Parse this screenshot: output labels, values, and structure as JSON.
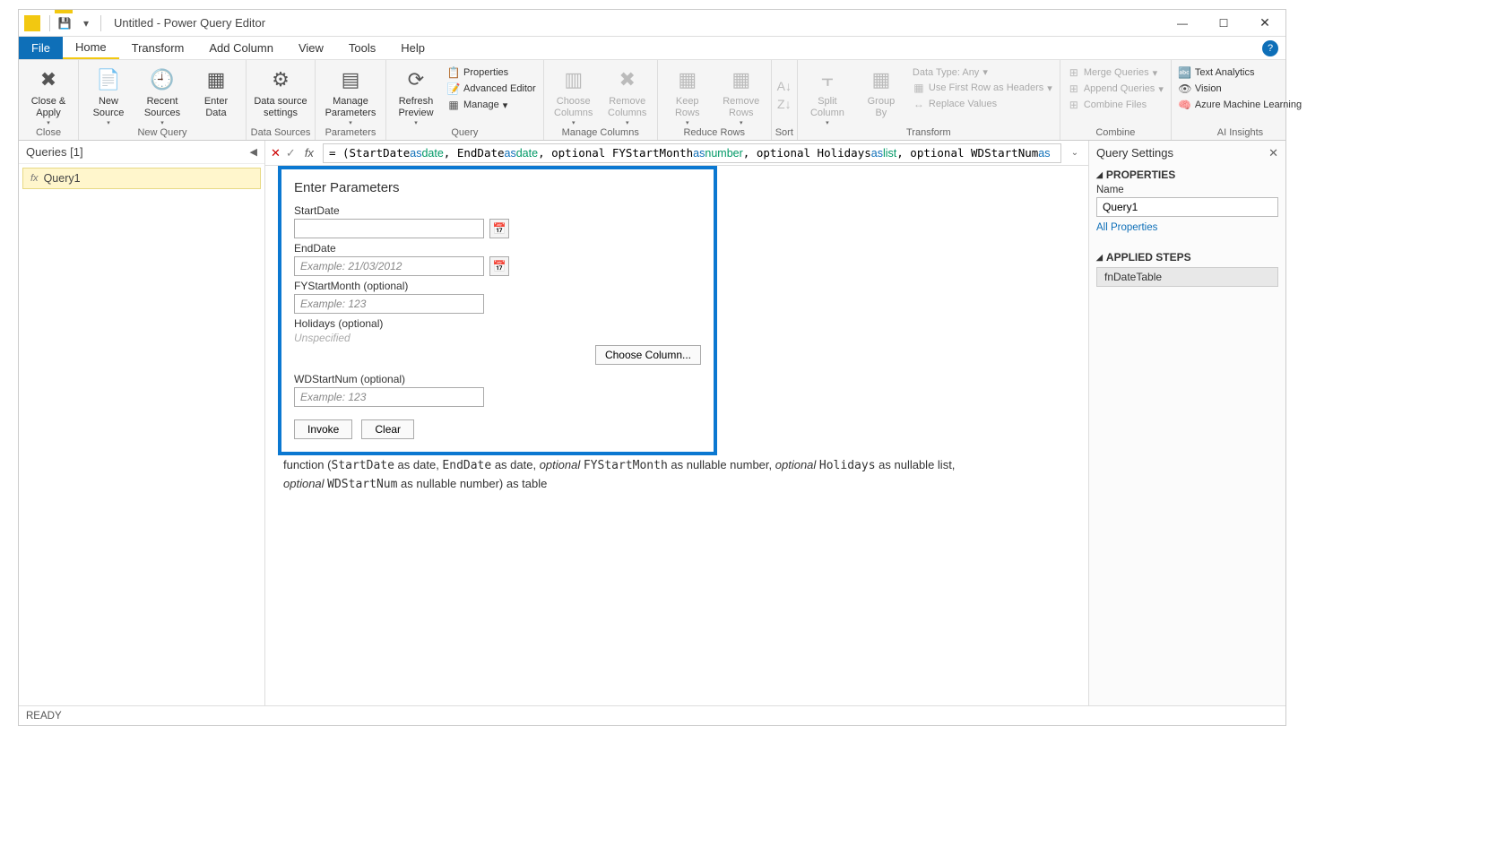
{
  "window": {
    "title": "Untitled - Power Query Editor",
    "minimize": "—",
    "maximize": "☐",
    "close": "✕"
  },
  "menu": {
    "file": "File",
    "home": "Home",
    "transform": "Transform",
    "add_column": "Add Column",
    "view": "View",
    "tools": "Tools",
    "help": "Help"
  },
  "ribbon": {
    "close": {
      "label": "Close &\nApply",
      "group": "Close"
    },
    "new_query": {
      "new_source": "New\nSource",
      "recent_sources": "Recent\nSources",
      "enter_data": "Enter\nData",
      "group": "New Query"
    },
    "data_sources": {
      "settings": "Data source\nsettings",
      "group": "Data Sources"
    },
    "parameters": {
      "manage": "Manage\nParameters",
      "group": "Parameters"
    },
    "query": {
      "refresh": "Refresh\nPreview",
      "properties": "Properties",
      "advanced": "Advanced Editor",
      "manage": "Manage",
      "group": "Query"
    },
    "manage_cols": {
      "choose": "Choose\nColumns",
      "remove": "Remove\nColumns",
      "group": "Manage Columns"
    },
    "reduce_rows": {
      "keep": "Keep\nRows",
      "remove": "Remove\nRows",
      "group": "Reduce Rows"
    },
    "sort": {
      "group": "Sort"
    },
    "transform": {
      "split": "Split\nColumn",
      "group_by": "Group\nBy",
      "data_type": "Data Type: Any",
      "first_row": "Use First Row as Headers",
      "replace": "Replace Values",
      "group": "Transform"
    },
    "combine": {
      "merge": "Merge Queries",
      "append": "Append Queries",
      "files": "Combine Files",
      "group": "Combine"
    },
    "ai": {
      "text": "Text Analytics",
      "vision": "Vision",
      "ml": "Azure Machine Learning",
      "group": "AI Insights"
    }
  },
  "formula": "= (StartDate as date, EndDate as date, optional FYStartMonth as number, optional Holidays as list, optional WDStartNum as",
  "queries": {
    "header": "Queries [1]",
    "item": "Query1"
  },
  "param_panel": {
    "title": "Enter Parameters",
    "start_date": "StartDate",
    "end_date": "EndDate",
    "end_placeholder": "Example: 21/03/2012",
    "fy": "FYStartMonth (optional)",
    "fy_placeholder": "Example: 123",
    "holidays": "Holidays (optional)",
    "unspecified": "Unspecified",
    "choose_col": "Choose Column...",
    "wd": "WDStartNum (optional)",
    "wd_placeholder": "Example: 123",
    "invoke": "Invoke",
    "clear": "Clear"
  },
  "signature": {
    "prefix": "function (",
    "p1": "StartDate",
    "t1": " as date, ",
    "p2": "EndDate",
    "t2": " as date, ",
    "opt1": "optional ",
    "p3": "FYStartMonth",
    "t3": " as nullable number, ",
    "opt2": "optional ",
    "p4": "Holidays",
    "t4": " as nullable list, ",
    "opt3": "optional ",
    "p5": "WDStartNum",
    "t5": " as nullable number) as table"
  },
  "settings": {
    "title": "Query Settings",
    "properties": "PROPERTIES",
    "name_label": "Name",
    "name_value": "Query1",
    "all_props": "All Properties",
    "applied_steps": "APPLIED STEPS",
    "step1": "fnDateTable"
  },
  "status": "READY"
}
